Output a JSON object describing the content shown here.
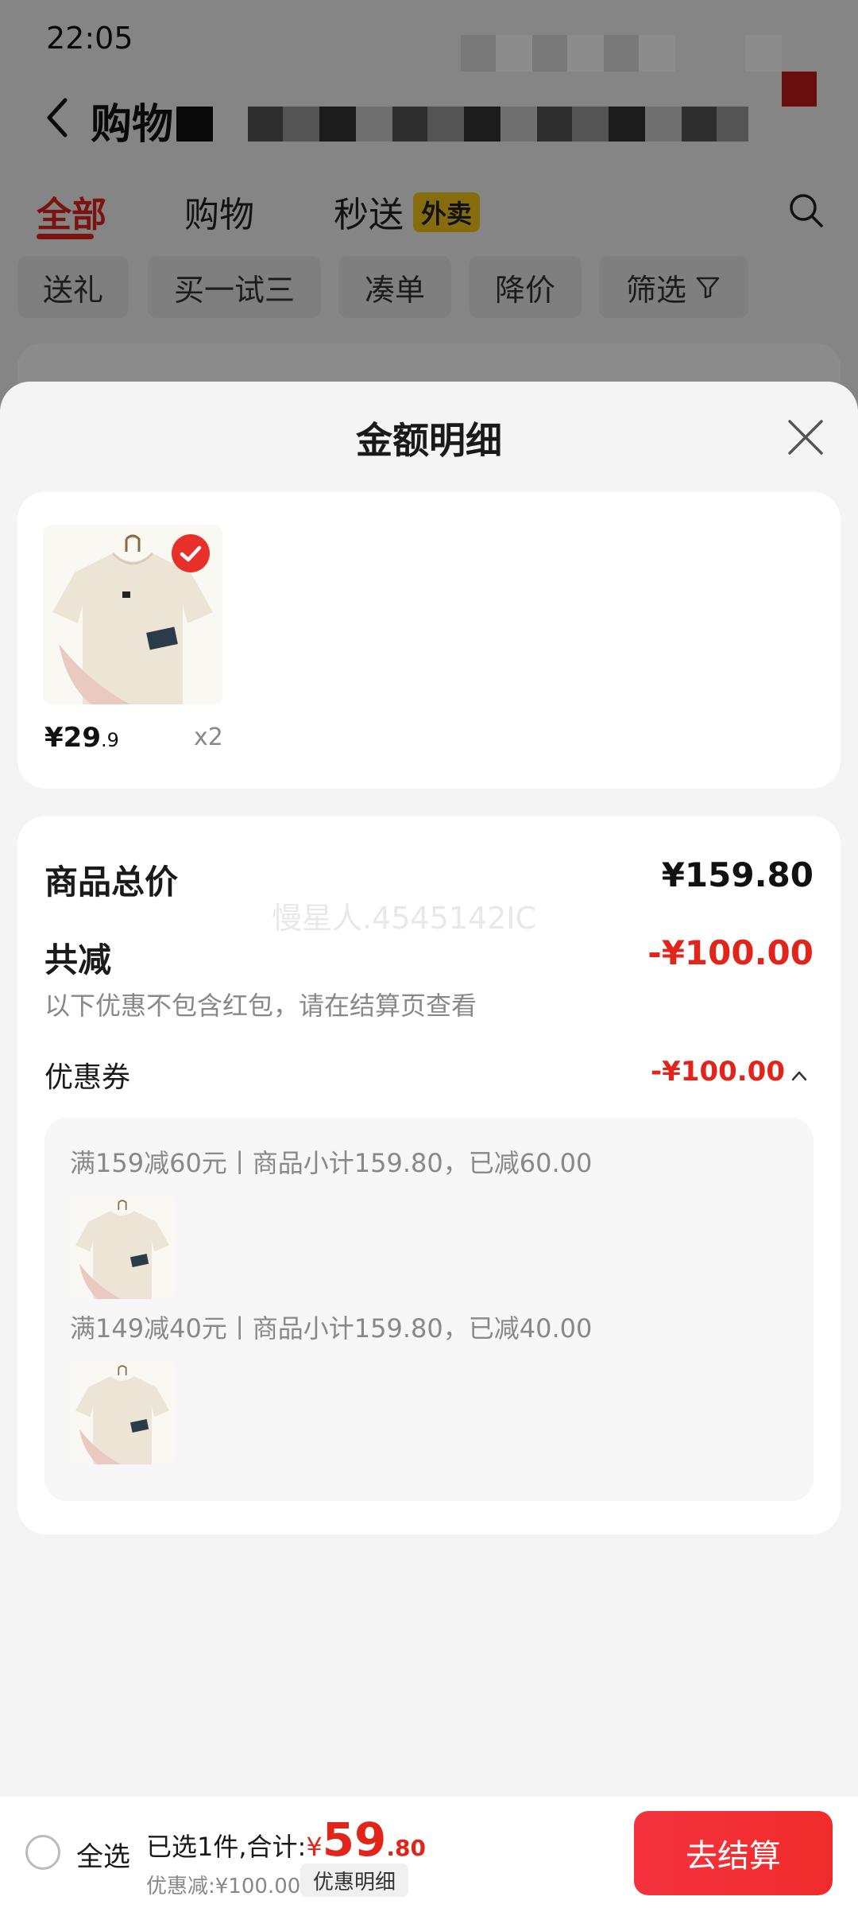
{
  "status_bar": {
    "time": "22:05"
  },
  "header": {
    "title": "购物"
  },
  "tabs": [
    {
      "label": "全部",
      "active": true
    },
    {
      "label": "购物",
      "active": false
    },
    {
      "label": "秒送",
      "active": false,
      "badge": "外卖"
    }
  ],
  "filter_chips": [
    "送礼",
    "买一试三",
    "凑单",
    "降价",
    "筛选"
  ],
  "sheet": {
    "title": "金额明细",
    "product": {
      "price_int": "¥29",
      "price_dec": ".9",
      "qty": "x2"
    },
    "summary": {
      "total_label": "商品总价",
      "total_value": "¥159.80",
      "watermark": "慢星人.4545142IC",
      "reduce_label": "共减",
      "reduce_value": "-¥100.00",
      "note": "以下优惠不包含红包，请在结算页查看",
      "coupon_label": "优惠券",
      "coupon_value": "-¥100.00",
      "coupons": [
        {
          "text": "满159减60元丨商品小计159.80，已减60.00"
        },
        {
          "text": "满149减40元丨商品小计159.80，已减40.00"
        }
      ]
    }
  },
  "bottom_bar": {
    "select_all": "全选",
    "selected_text": "已选1件,合计:",
    "yen": "¥",
    "total_int": "59",
    "total_dec": ".80",
    "discount_text": "优惠减:¥100.00",
    "detail_label": "优惠明细",
    "checkout_label": "去结算"
  },
  "colors": {
    "accent_red": "#e1251b",
    "badge_yellow": "#f5c518"
  }
}
